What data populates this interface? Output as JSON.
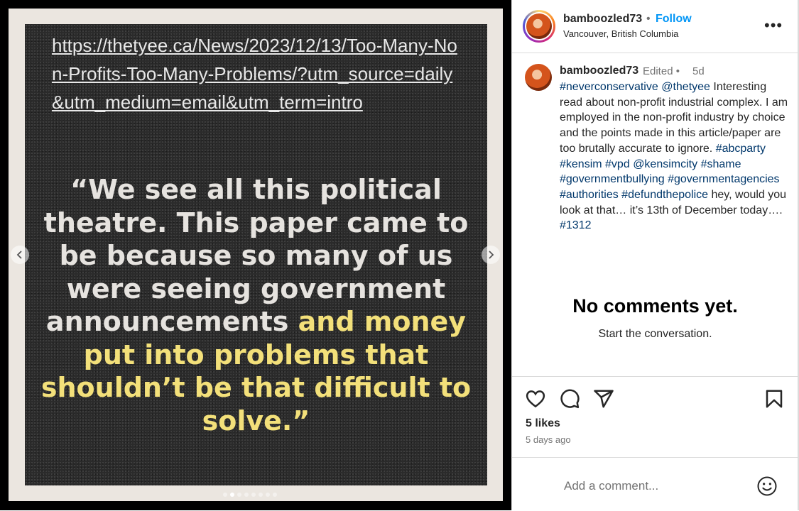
{
  "post_image": {
    "url_text": "https://thetyee.ca/News/2023/12/13/Too-Many-Non-Profits-Too-Many-Problems/?utm_source=daily&utm_medium=email&utm_term=intro",
    "quote_white": "“We see all this political theatre. This paper came to be because so many of us were seeing government announcements",
    "quote_yellow": "and money put into problems that shouldn’t be that difficult to solve.”",
    "carousel_dots": 8,
    "active_dot": 2,
    "highlight_color": "#f3e07a"
  },
  "header": {
    "username": "bamboozled73",
    "separator": "•",
    "follow_label": "Follow",
    "location": "Vancouver, British Columbia",
    "more_label": "•••"
  },
  "caption": {
    "username": "bamboozled73",
    "edited": "Edited •",
    "time": "5d",
    "segments": [
      {
        "text": "#neverconservative",
        "tag": true
      },
      {
        "text": " ",
        "tag": false
      },
      {
        "text": "@thetyee",
        "tag": true
      },
      {
        "text": " Interesting read about non-profit industrial complex. I am employed in the non-profit industry by choice and the points made in this article/paper are too brutally accurate to ignore. ",
        "tag": false
      },
      {
        "text": "#abcparty",
        "tag": true
      },
      {
        "text": " ",
        "tag": false
      },
      {
        "text": "#kensim",
        "tag": true
      },
      {
        "text": " ",
        "tag": false
      },
      {
        "text": "#vpd",
        "tag": true
      },
      {
        "text": " ",
        "tag": false
      },
      {
        "text": "@kensimcity",
        "tag": true
      },
      {
        "text": " ",
        "tag": false
      },
      {
        "text": "#shame",
        "tag": true
      },
      {
        "text": " ",
        "tag": false
      },
      {
        "text": "#governmentbullying",
        "tag": true
      },
      {
        "text": " ",
        "tag": false
      },
      {
        "text": "#governmentagencies",
        "tag": true
      },
      {
        "text": " ",
        "tag": false
      },
      {
        "text": "#authorities",
        "tag": true
      },
      {
        "text": " ",
        "tag": false
      },
      {
        "text": "#defundthepolice",
        "tag": true
      },
      {
        "text": " hey, would you look at that… it’s 13th of December today…. ",
        "tag": false
      },
      {
        "text": "#1312",
        "tag": true
      }
    ]
  },
  "comments": {
    "empty_title": "No comments yet.",
    "empty_subtitle": "Start the conversation."
  },
  "actions": {
    "icons": [
      "heart-icon",
      "comment-icon",
      "share-icon",
      "bookmark-icon"
    ],
    "likes": "5 likes",
    "time_ago": "5 days ago"
  },
  "add_comment": {
    "placeholder": "Add a comment...",
    "emoji_icon": "emoji-icon"
  },
  "colors": {
    "follow": "#0095f6",
    "hashtag": "#00376b"
  }
}
